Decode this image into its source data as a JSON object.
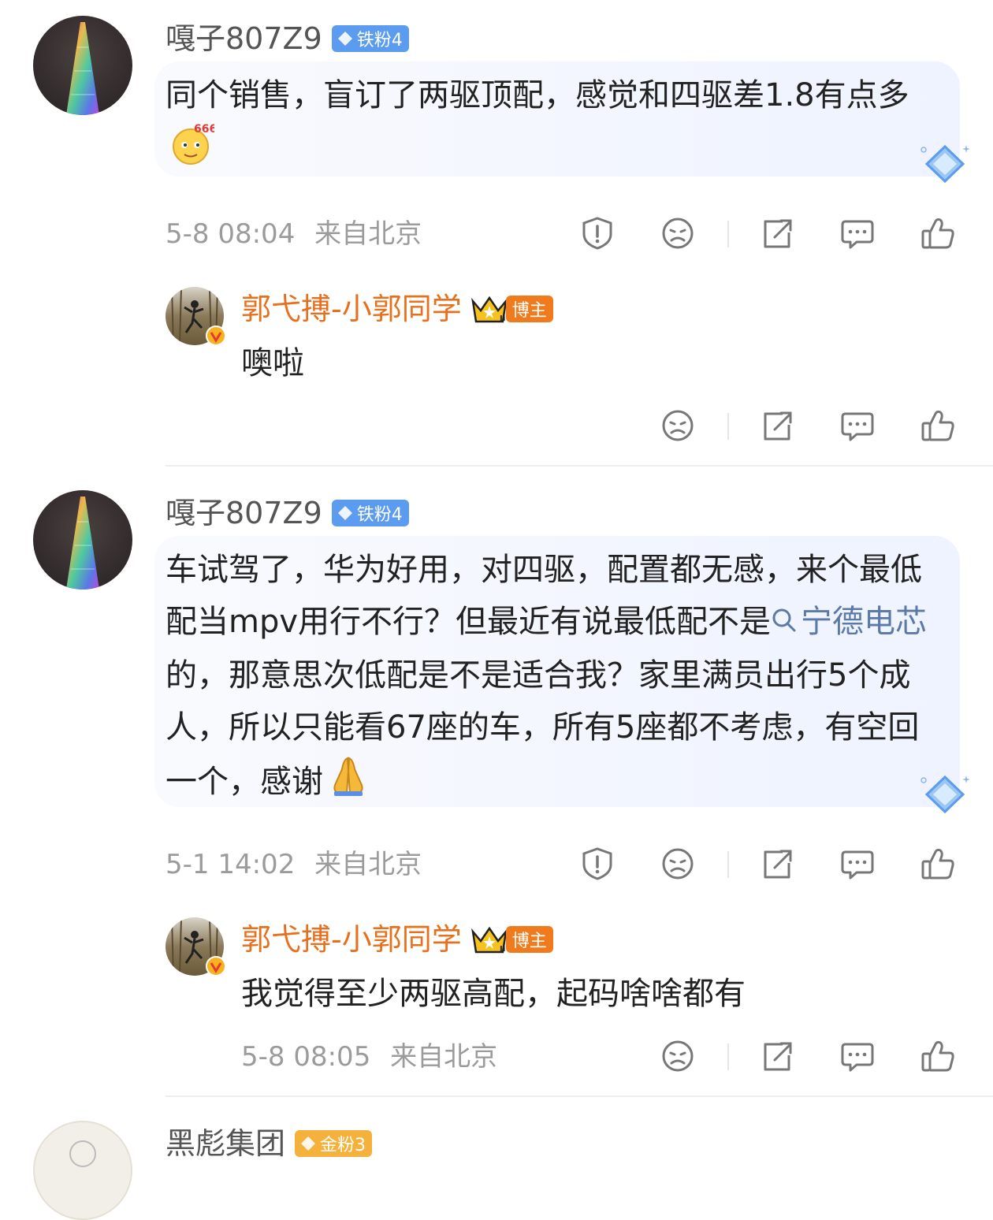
{
  "comments": [
    {
      "username": "嘎子807Z9",
      "fan_badge": "铁粉4",
      "text": "同个销售，盲订了两驱顶配，感觉和四驱差1.8有点多",
      "time": "5-8 08:04",
      "location": "来自北京",
      "reply": {
        "username": "郭弋搏-小郭同学",
        "badge": "博主",
        "text": "噢啦"
      }
    },
    {
      "username": "嘎子807Z9",
      "fan_badge": "铁粉4",
      "text_before_topic": "车试驾了，华为好用，对四驱，配置都无感，来个最低配当mpv用行不行？但最近有说最低配不是",
      "topic": "宁德电芯",
      "text_after_topic": "的，那意思次低配是不是适合我？家里满员出行5个成人，所以只能看67座的车，所有5座都不考虑，有空回一个，感谢",
      "time": "5-1 14:02",
      "location": "来自北京",
      "reply": {
        "username": "郭弋搏-小郭同学",
        "badge": "博主",
        "text": "我觉得至少两驱高配，起码啥啥都有",
        "time": "5-8 08:05",
        "location": "来自北京"
      }
    },
    {
      "username": "黑彪集团",
      "fan_badge": "金粉3"
    }
  ],
  "emojis": {
    "comment1_end": "666-emoji",
    "comment2_end": "pray-emoji"
  },
  "colors": {
    "username": "#555555",
    "owner_name": "#e86f1c",
    "fan_badge": "#5b9cf0",
    "owner_badge": "#f07b1c",
    "topic_link": "#5b7aa8",
    "meta": "#9b9b9b"
  }
}
